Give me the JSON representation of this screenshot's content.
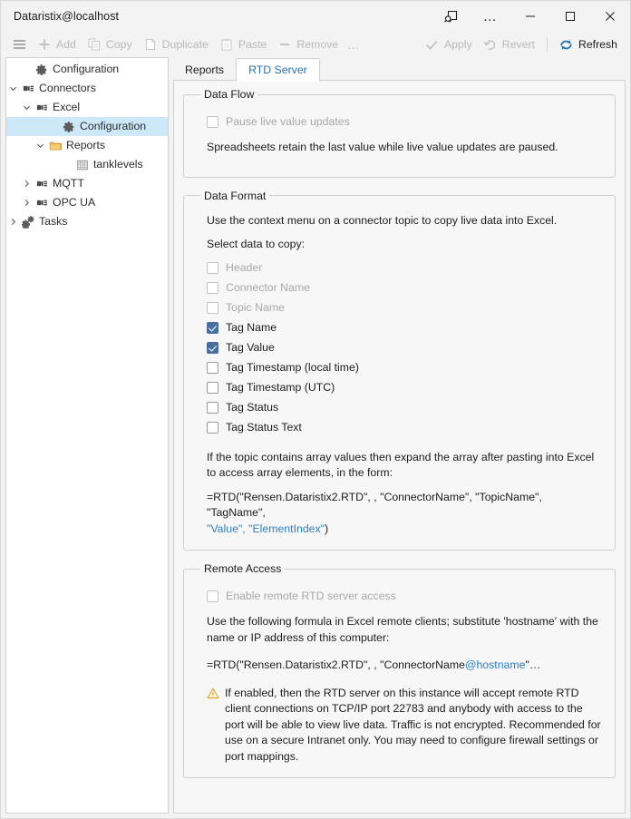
{
  "window": {
    "title": "Dataristix@localhost",
    "controls": {
      "search_panel": "search-panel-icon",
      "more": "…",
      "minimize": "minimize-icon",
      "maximize": "maximize-icon",
      "close": "close-icon"
    }
  },
  "toolbar": {
    "menu_label": "menu-icon",
    "items": [
      {
        "label": "Add",
        "icon": "plus-icon",
        "enabled": false
      },
      {
        "label": "Copy",
        "icon": "copy-icon",
        "enabled": false
      },
      {
        "label": "Duplicate",
        "icon": "duplicate-icon",
        "enabled": false
      },
      {
        "label": "Paste",
        "icon": "paste-icon",
        "enabled": false
      },
      {
        "label": "Remove",
        "icon": "minus-icon",
        "enabled": false
      }
    ],
    "overflow": "…",
    "right_items": [
      {
        "label": "Apply",
        "icon": "check-icon",
        "enabled": false
      },
      {
        "label": "Revert",
        "icon": "undo-icon",
        "enabled": false
      },
      {
        "label": "Refresh",
        "icon": "refresh-icon",
        "enabled": true
      }
    ]
  },
  "tree": {
    "nodes": [
      {
        "label": "Configuration",
        "icon": "gear-icon",
        "depth": 1,
        "twisty": "none",
        "selected": false
      },
      {
        "label": "Connectors",
        "icon": "connector-icon",
        "depth": 0,
        "twisty": "expanded",
        "selected": false
      },
      {
        "label": "Excel",
        "icon": "connector-icon",
        "depth": 1,
        "twisty": "expanded",
        "selected": false
      },
      {
        "label": "Configuration",
        "icon": "gear-icon",
        "depth": 3,
        "twisty": "none",
        "selected": true
      },
      {
        "label": "Reports",
        "icon": "folder-icon",
        "depth": 2,
        "twisty": "expanded",
        "selected": false
      },
      {
        "label": "tanklevels",
        "icon": "grid-icon",
        "depth": 4,
        "twisty": "none",
        "selected": false
      },
      {
        "label": "MQTT",
        "icon": "connector-icon",
        "depth": 1,
        "twisty": "collapsed",
        "selected": false
      },
      {
        "label": "OPC UA",
        "icon": "connector-icon",
        "depth": 1,
        "twisty": "collapsed",
        "selected": false
      },
      {
        "label": "Tasks",
        "icon": "tasks-icon",
        "depth": 0,
        "twisty": "collapsed",
        "selected": false
      }
    ]
  },
  "tabs": [
    {
      "label": "Reports",
      "active": false
    },
    {
      "label": "RTD Server",
      "active": true
    }
  ],
  "data_flow": {
    "legend": "Data Flow",
    "pause_checkbox": {
      "label": "Pause live value updates",
      "checked": false,
      "enabled": false
    },
    "note": "Spreadsheets retain the last value while live value updates are paused."
  },
  "data_format": {
    "legend": "Data Format",
    "intro": "Use the context menu on a connector topic to copy live data into Excel.",
    "select_label": "Select data to copy:",
    "checkboxes": [
      {
        "label": "Header",
        "checked": false,
        "enabled": false
      },
      {
        "label": "Connector Name",
        "checked": false,
        "enabled": false
      },
      {
        "label": "Topic Name",
        "checked": false,
        "enabled": false
      },
      {
        "label": "Tag Name",
        "checked": true,
        "enabled": true
      },
      {
        "label": "Tag Value",
        "checked": true,
        "enabled": true
      },
      {
        "label": "Tag Timestamp (local time)",
        "checked": false,
        "enabled": true
      },
      {
        "label": "Tag Timestamp (UTC)",
        "checked": false,
        "enabled": true
      },
      {
        "label": "Tag Status",
        "checked": false,
        "enabled": true
      },
      {
        "label": "Tag Status Text",
        "checked": false,
        "enabled": true
      }
    ],
    "array_note": "If the topic contains array values then expand the array after pasting into Excel to access array elements, in the form:",
    "formula_plain": "=RTD(\"Rensen.Dataristix2.RTD\", , \"ConnectorName\", \"TopicName\", \"TagName\",",
    "formula_highlight": "\"Value\", \"ElementIndex\"",
    "formula_tail": ")"
  },
  "remote_access": {
    "legend": "Remote Access",
    "enable_checkbox": {
      "label": "Enable remote RTD server access",
      "checked": false,
      "enabled": false
    },
    "note": "Use the following formula in Excel remote clients; substitute 'hostname' with the name or IP address of this computer:",
    "formula_plain": "=RTD(\"Rensen.Dataristix2.RTD\", , \"ConnectorName",
    "formula_highlight": "@hostname",
    "formula_tail": "\"…",
    "warning": "If enabled, then the RTD server on this instance will accept remote RTD client connections on TCP/IP port 22783 and anybody with access to the port will be able to view live data. Traffic is not encrypted. Recommended for use on a secure Intranet only. You may need to configure firewall settings or port mappings."
  },
  "colors": {
    "accent_blue": "#2a7fc4",
    "selection": "#cde8f9",
    "checkbox_fill": "#4a6f9e",
    "warning": "#e0a21c"
  }
}
